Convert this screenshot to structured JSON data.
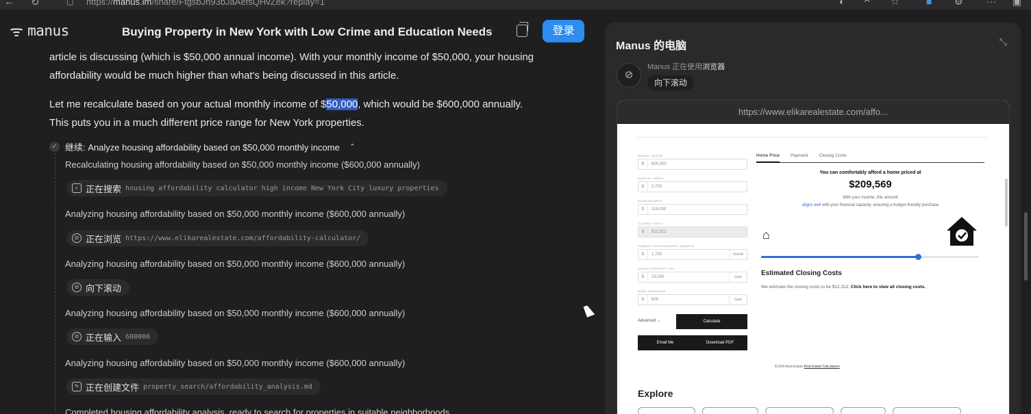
{
  "browser": {
    "url_prefix": "https://",
    "url_domain": "manus.im",
    "url_rest": "/share/FtgsbJh93bJaAefsQHvZek?replay=1"
  },
  "header": {
    "logo_text": "manus",
    "title": "Buying Property in New York with Low Crime and Education Needs",
    "login_label": "登录"
  },
  "chat": {
    "para1": "article is discussing (which is $50,000 annual income). With your monthly income of $50,000, your housing affordability would be much higher than what's being discussed in this article.",
    "para2_before": "Let me recalculate based on your actual monthly income of $",
    "para2_highlight": "50,000",
    "para2_after": ", which would be $600,000 annually. This puts you in a much different price range for New York properties.",
    "task_label": "继续:  Analyze housing affordability based on $50,000 monthly income",
    "steps": [
      "Recalculating housing affordability based on $50,000 monthly income ($600,000 annually)",
      "Analyzing housing affordability based on $50,000 monthly income ($600,000 annually)",
      "Analyzing housing affordability based on $50,000 monthly income ($600,000 annually)",
      "Analyzing housing affordability based on $50,000 monthly income ($600,000 annually)",
      "Analyzing housing affordability based on $50,000 monthly income ($600,000 annually)",
      "Completed housing affordability analysis, ready to search for properties in suitable neighborhoods"
    ],
    "chips": [
      {
        "icon": "search-icon",
        "action": "正在搜索",
        "arg": "housing affordability calculator high income New York City luxury properties"
      },
      {
        "icon": "browse-icon",
        "action": "正在浏览",
        "arg": "https://www.elikarealestate.com/affordability-calculator/"
      },
      {
        "icon": "browse-icon",
        "action": "向下滚动",
        "arg": ""
      },
      {
        "icon": "browse-icon",
        "action": "正在输入",
        "arg": "600000"
      },
      {
        "icon": "edit-icon",
        "action": "正在创建文件",
        "arg": "property_search/affordability_analysis.md"
      }
    ]
  },
  "computer": {
    "title": "Manus 的电脑",
    "status_prefix": "Manus 正在使用",
    "status_tool": "浏览器",
    "current_action": "向下滚动",
    "url": "https://www.elikarealestate.com/affo...",
    "calculator": {
      "fields": [
        {
          "label": "ANNUAL INCOME",
          "value": "600,000",
          "suffix": ""
        },
        {
          "label": "MONTHLY DEBTS",
          "value": "3,700",
          "suffix": ""
        },
        {
          "label": "DOWN PAYMENT",
          "value": "115,000",
          "suffix": ""
        },
        {
          "label": "CLOSING COSTS",
          "value": "$12,312",
          "suffix": ""
        },
        {
          "label": "COMMON CHARGES/MAINT. AMENITIE",
          "value": "1,700",
          "suffix": "/month"
        },
        {
          "label": "ANNUAL PROPERTY TAX",
          "value": "15,000",
          "suffix": "/year"
        },
        {
          "label": "HOME INSURANCE",
          "value": "600",
          "suffix": "/year"
        }
      ],
      "advanced_label": "Advanced",
      "calculate_label": "Calculate",
      "email_label": "Email Me",
      "download_label": "Download PDF",
      "footer_text": "ELIKA Real Estate",
      "footer_link": "Real Estate Calculators",
      "tabs": [
        "Home Price",
        "Payment",
        "Closing Costs"
      ],
      "afford_text": "You can comfortably afford a home priced at",
      "price": "$209,569",
      "desc_line1": "With your income, this amount",
      "desc_link": "aligns well",
      "desc_line2": " with your financial capacity, ensuring a budget-friendly purchase",
      "slider_fraction": 0.72,
      "closing_title": "Estimated Closing Costs",
      "closing_text_before": "We estimate the closing costs to be $12,312. ",
      "closing_text_link": "Click here to view all closing costs.",
      "explore_title": "Explore"
    }
  }
}
